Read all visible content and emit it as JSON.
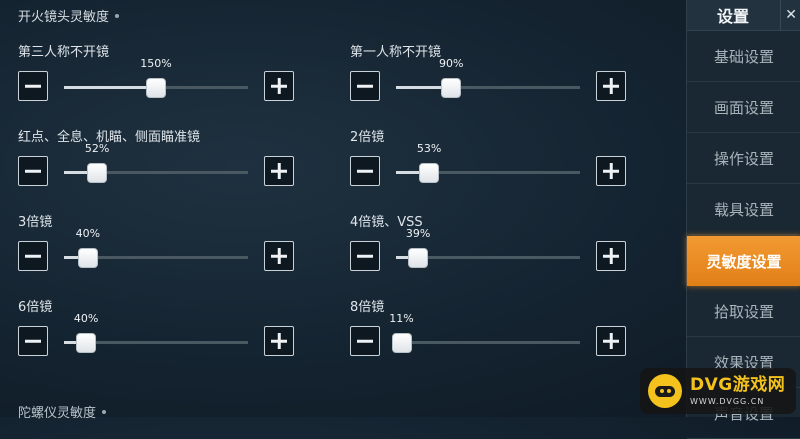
{
  "section": {
    "title": "开火镜头灵敏度",
    "next_title": "陀螺仪灵敏度"
  },
  "settings": [
    {
      "label": "第三人称不开镜",
      "value": "150%",
      "percent": 0.5
    },
    {
      "label": "第一人称不开镜",
      "value": "90%",
      "percent": 0.3
    },
    {
      "label": "红点、全息、机瞄、侧面瞄准镜",
      "value": "52%",
      "percent": 0.18
    },
    {
      "label": "2倍镜",
      "value": "53%",
      "percent": 0.18
    },
    {
      "label": "3倍镜",
      "value": "40%",
      "percent": 0.13
    },
    {
      "label": "4倍镜、VSS",
      "value": "39%",
      "percent": 0.12
    },
    {
      "label": "6倍镜",
      "value": "40%",
      "percent": 0.12
    },
    {
      "label": "8倍镜",
      "value": "11%",
      "percent": 0.03
    }
  ],
  "sidebar": {
    "title": "设置",
    "close_glyph": "✕",
    "items": [
      {
        "label": "基础设置"
      },
      {
        "label": "画面设置"
      },
      {
        "label": "操作设置"
      },
      {
        "label": "载具设置"
      },
      {
        "label": "灵敏度设置"
      },
      {
        "label": "拾取设置"
      },
      {
        "label": "效果设置"
      },
      {
        "label": "声音设置"
      }
    ]
  },
  "watermark": {
    "main": "DVG游戏网",
    "sub": "WWW.DVGG.CN"
  },
  "colors": {
    "accent": "#e8891f",
    "background": "#142330"
  }
}
